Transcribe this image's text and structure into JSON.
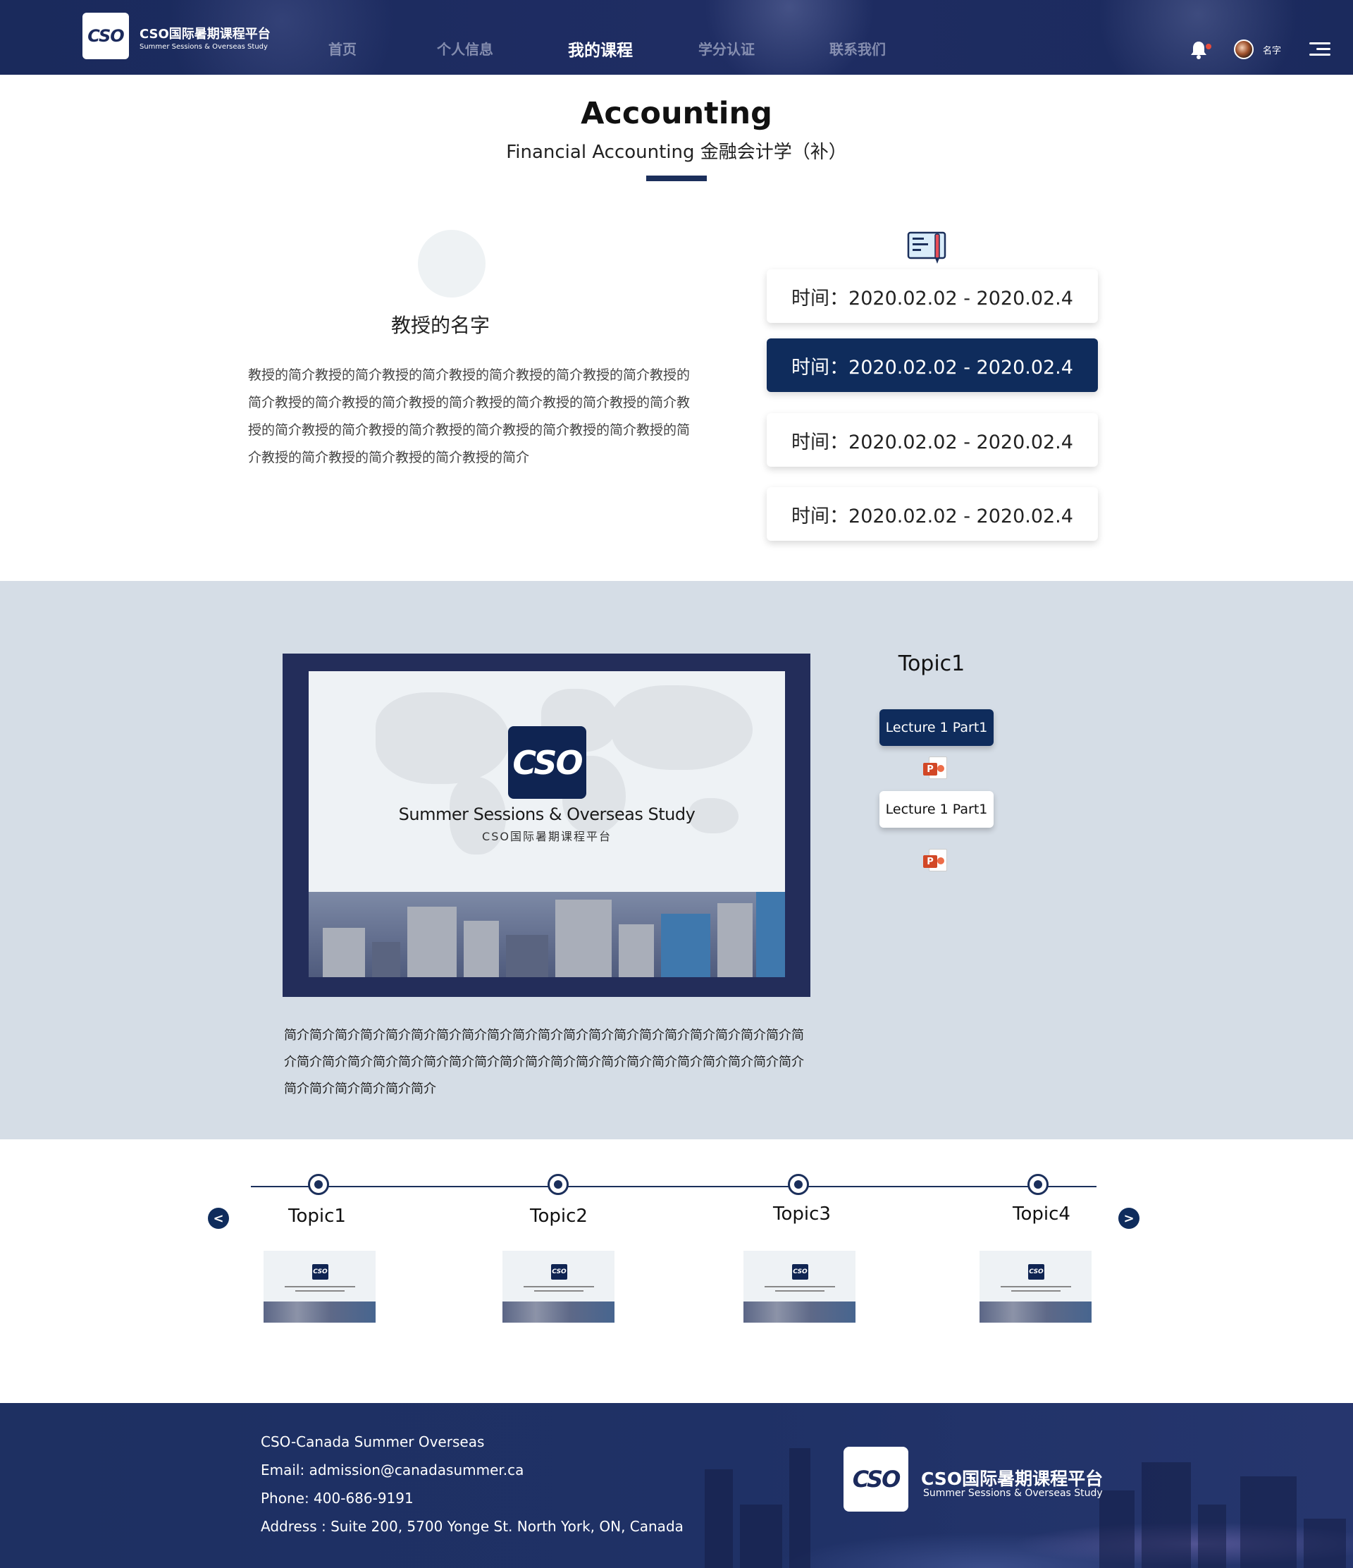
{
  "header": {
    "logo_text": "CSO",
    "brand_cn": "CSO国际暑期课程平台",
    "brand_en": "Summer Sessions & Overseas Study",
    "nav": [
      {
        "label": "首页",
        "active": false
      },
      {
        "label": "个人信息",
        "active": false
      },
      {
        "label": "我的课程",
        "active": true
      },
      {
        "label": "学分认证",
        "active": false
      },
      {
        "label": "联系我们",
        "active": false
      }
    ],
    "user_name": "名字",
    "icons": {
      "bell": "bell-icon",
      "menu": "menu-icon"
    }
  },
  "course": {
    "title": "Accounting",
    "subtitle": "Financial Accounting 金融会计学（补）"
  },
  "professor": {
    "name": "教授的名字",
    "bio": "教授的简介教授的简介教授的简介教授的简介教授的简介教授的简介教授的简介教授的简介教授的简介教授的简介教授的简介教授的简介教授的简介教授的简介教授的简介教授的简介教授的简介教授的简介教授的简介教授的简介教授的简介教授的简介教授的简介教授的简介"
  },
  "schedule": {
    "icon": "schedule-icon",
    "items": [
      {
        "label": "时间：2020.02.02 - 2020.02.4",
        "active": false
      },
      {
        "label": "时间：2020.02.02 - 2020.02.4",
        "active": true
      },
      {
        "label": "时间：2020.02.02 - 2020.02.4",
        "active": false
      },
      {
        "label": "时间：2020.02.02 - 2020.02.4",
        "active": false
      }
    ]
  },
  "slide": {
    "logo_text": "CSO",
    "title_en": "Summer Sessions & Overseas Study",
    "title_cn": "CSO国际暑期课程平台",
    "description": "简介简介简介简介简介简介简介简介简介简介简介简介简介简介简介简介简介简介简介简介简介简介简介简介简介简介简介简介简介简介简介简介简介简介简介简介简介简介简介简介简介简介简介简介简介简介简介"
  },
  "topic_panel": {
    "title": "Topic1",
    "lectures": [
      {
        "label": "Lecture 1 Part1",
        "active": true,
        "file_icon": "powerpoint-icon"
      },
      {
        "label": "Lecture 1 Part1",
        "active": false,
        "file_icon": "powerpoint-icon"
      }
    ]
  },
  "timeline": {
    "prev": "<",
    "next": ">",
    "topics": [
      "Topic1",
      "Topic2",
      "Topic3",
      "Topic4"
    ]
  },
  "footer": {
    "lines": [
      "CSO-Canada Summer Overseas",
      "Email: admission@canadasummer.ca",
      "Phone: 400-686-9191",
      "Address : Suite 200, 5700 Yonge St. North York, ON, Canada"
    ],
    "logo_text": "CSO",
    "brand_cn": "CSO国际暑期课程平台",
    "brand_en": "Summer Sessions & Overseas Study"
  },
  "colors": {
    "navy": "#0f2c5c",
    "header_bg": "#1f2d63",
    "section_bg": "#d5dde6"
  }
}
